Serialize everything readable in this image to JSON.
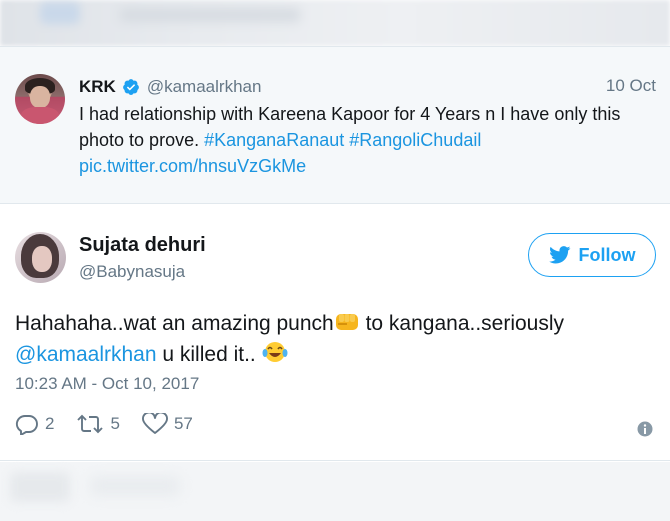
{
  "quoted_tweet": {
    "name": "KRK",
    "handle": "@kamaalrkhan",
    "date": "10 Oct",
    "text_plain": "I had relationship with Kareena Kapoor for 4 Years n I have only this photo to prove.",
    "hashtag1": "#KanganaRanaut",
    "hashtag2": "#RangoliChudail",
    "pic_link": "pic.twitter.com/hnsuVzGkMe"
  },
  "main_tweet": {
    "name": "Sujata dehuri",
    "handle": "@Babynasuja",
    "follow_label": "Follow",
    "text_part1": "Hahahaha..wat an amazing punch",
    "text_part2": " to kangana..seriously",
    "mention": "@kamaalrkhan",
    "text_part3": " u killed it.. ",
    "timestamp": "10:23 AM - Oct 10, 2017",
    "replies": "2",
    "retweets": "5",
    "likes": "57"
  },
  "colors": {
    "link": "#1b95e0",
    "accent": "#1da1f2",
    "muted": "#657786",
    "quoted_bg": "#f5f8fa"
  },
  "icons": {
    "verified": "verified-badge-icon",
    "bird": "twitter-bird-icon",
    "punch": "fist-emoji-icon",
    "laugh": "tears-of-joy-emoji-icon",
    "reply": "reply-icon",
    "retweet": "retweet-icon",
    "like": "heart-icon",
    "info": "info-icon"
  }
}
